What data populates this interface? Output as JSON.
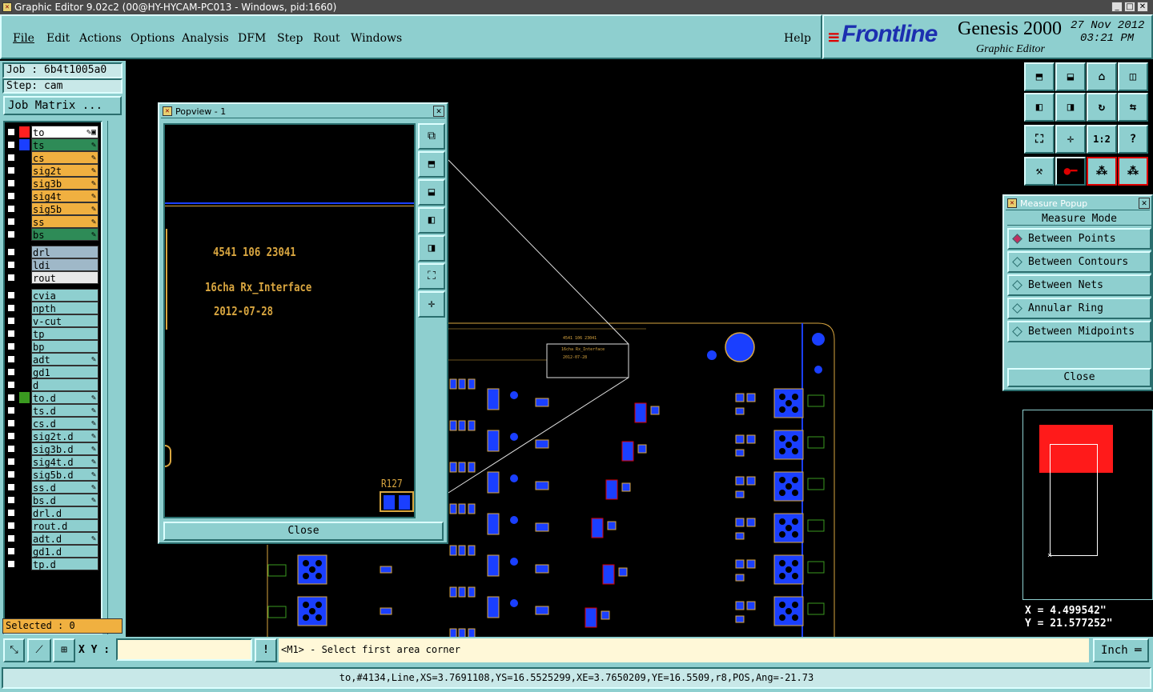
{
  "window": {
    "title": "Graphic Editor 9.02c2 (00@HY-HYCAM-PC013 - Windows, pid:1660)"
  },
  "menu": [
    "File",
    "Edit",
    "Actions",
    "Options",
    "Analysis",
    "DFM",
    "Step",
    "Rout",
    "Windows"
  ],
  "help_label": "Help",
  "brand": {
    "logo": "Frontline",
    "product": "Genesis 2000",
    "subtitle": "Graphic Editor",
    "date": "27 Nov 2012",
    "time": "03:21 PM"
  },
  "job": {
    "job_label": "Job : 6b4t1005a0",
    "step_label": "Step: cam",
    "matrix_button": "Job Matrix ..."
  },
  "layers": [
    {
      "name": "to",
      "color": "#ff2020",
      "bg": "#ffffff",
      "lock": "✎▣"
    },
    {
      "name": "ts",
      "color": "#1a3fff",
      "bg": "#2e8b57",
      "lock": "✎"
    },
    {
      "name": "cs",
      "color": "",
      "bg": "#f0b040",
      "lock": "✎"
    },
    {
      "name": "sig2t",
      "color": "",
      "bg": "#f0b040",
      "lock": "✎"
    },
    {
      "name": "sig3b",
      "color": "",
      "bg": "#f0b040",
      "lock": "✎"
    },
    {
      "name": "sig4t",
      "color": "",
      "bg": "#f0b040",
      "lock": "✎"
    },
    {
      "name": "sig5b",
      "color": "",
      "bg": "#f0b040",
      "lock": "✎"
    },
    {
      "name": "ss",
      "color": "",
      "bg": "#f0b040",
      "lock": "✎"
    },
    {
      "name": "bs",
      "color": "",
      "bg": "#2e8b57",
      "lock": "✎"
    },
    {
      "name": "drl",
      "color": "",
      "bg": "#9fb8c8",
      "lock": ""
    },
    {
      "name": "ldi",
      "color": "",
      "bg": "#9fb8c8",
      "lock": ""
    },
    {
      "name": "rout",
      "color": "",
      "bg": "#e8e8e8",
      "lock": ""
    },
    {
      "name": "cvia",
      "color": "",
      "bg": "#8ecfcf",
      "lock": ""
    },
    {
      "name": "npth",
      "color": "",
      "bg": "#8ecfcf",
      "lock": ""
    },
    {
      "name": "v-cut",
      "color": "",
      "bg": "#8ecfcf",
      "lock": ""
    },
    {
      "name": "tp",
      "color": "",
      "bg": "#8ecfcf",
      "lock": ""
    },
    {
      "name": "bp",
      "color": "",
      "bg": "#8ecfcf",
      "lock": ""
    },
    {
      "name": "adt",
      "color": "",
      "bg": "#8ecfcf",
      "lock": "✎"
    },
    {
      "name": "gd1",
      "color": "",
      "bg": "#8ecfcf",
      "lock": ""
    },
    {
      "name": "d",
      "color": "",
      "bg": "#8ecfcf",
      "lock": ""
    },
    {
      "name": "to.d",
      "color": "#3a9a20",
      "bg": "#8ecfcf",
      "lock": "✎"
    },
    {
      "name": "ts.d",
      "color": "",
      "bg": "#8ecfcf",
      "lock": "✎"
    },
    {
      "name": "cs.d",
      "color": "",
      "bg": "#8ecfcf",
      "lock": "✎"
    },
    {
      "name": "sig2t.d",
      "color": "",
      "bg": "#8ecfcf",
      "lock": "✎"
    },
    {
      "name": "sig3b.d",
      "color": "",
      "bg": "#8ecfcf",
      "lock": "✎"
    },
    {
      "name": "sig4t.d",
      "color": "",
      "bg": "#8ecfcf",
      "lock": "✎"
    },
    {
      "name": "sig5b.d",
      "color": "",
      "bg": "#8ecfcf",
      "lock": "✎"
    },
    {
      "name": "ss.d",
      "color": "",
      "bg": "#8ecfcf",
      "lock": "✎"
    },
    {
      "name": "bs.d",
      "color": "",
      "bg": "#8ecfcf",
      "lock": "✎"
    },
    {
      "name": "drl.d",
      "color": "",
      "bg": "#8ecfcf",
      "lock": ""
    },
    {
      "name": "rout.d",
      "color": "",
      "bg": "#8ecfcf",
      "lock": ""
    },
    {
      "name": "adt.d",
      "color": "",
      "bg": "#8ecfcf",
      "lock": "✎"
    },
    {
      "name": "gd1.d",
      "color": "",
      "bg": "#8ecfcf",
      "lock": ""
    },
    {
      "name": "tp.d",
      "color": "",
      "bg": "#8ecfcf",
      "lock": ""
    }
  ],
  "selected_label": "Selected : 0",
  "popview": {
    "title": "Popview - 1",
    "text1": "4541 106 23041",
    "text2": "16cha Rx_Interface",
    "text3": "2012-07-28",
    "component": "R127",
    "close_label": "Close"
  },
  "board_text": {
    "line1": "4541 106 23041",
    "line2": "16cha Rx_Interface",
    "line3": "2012-07-28"
  },
  "measure": {
    "title": "Measure Popup",
    "mode_label": "Measure Mode",
    "options": [
      "Between Points",
      "Between Contours",
      "Between Nets",
      "Annular Ring",
      "Between Midpoints"
    ],
    "selected": "Between Points",
    "close_label": "Close"
  },
  "coords": {
    "x": "X =  4.499542\"",
    "y": "Y = 21.577252\""
  },
  "status": {
    "xy_label": "X Y :",
    "xy_value": "",
    "prompt": "<M1> - Select first area corner",
    "units": "Inch",
    "info": "to,#4134,Line,XS=3.7691108,YS=16.5525299,XE=3.7650209,YE=16.5509,r8,POS,Ang=-21.73"
  },
  "colors": {
    "panel": "#8ecfcf",
    "pcb_pad": "#1a3fff",
    "silk": "#d9a640",
    "highlight": "#ff1a1a"
  }
}
